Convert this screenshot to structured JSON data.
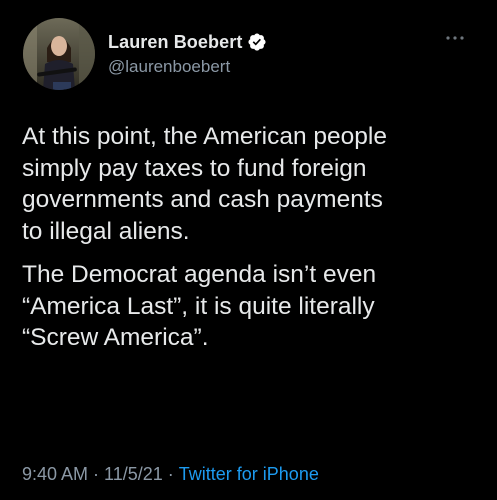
{
  "tweet": {
    "author": {
      "display_name": "Lauren Boebert",
      "handle": "@laurenboebert",
      "verified": true
    },
    "text_paragraphs": [
      "At this point, the American people\nsimply pay taxes to fund foreign\ngovernments and cash payments\nto illegal aliens.",
      "The Democrat agenda isn’t even\n“America Last”, it is quite literally\n“Screw America”."
    ],
    "meta": {
      "time": "9:40 AM",
      "separator": "·",
      "date": "11/5/21",
      "source": "Twitter for iPhone"
    },
    "icons": {
      "verified": "verified-badge-icon",
      "more": "more-dots-icon"
    },
    "colors": {
      "background": "#000000",
      "text": "#e7e9ea",
      "secondary": "#8b98a5",
      "link": "#1d9bf0"
    }
  }
}
